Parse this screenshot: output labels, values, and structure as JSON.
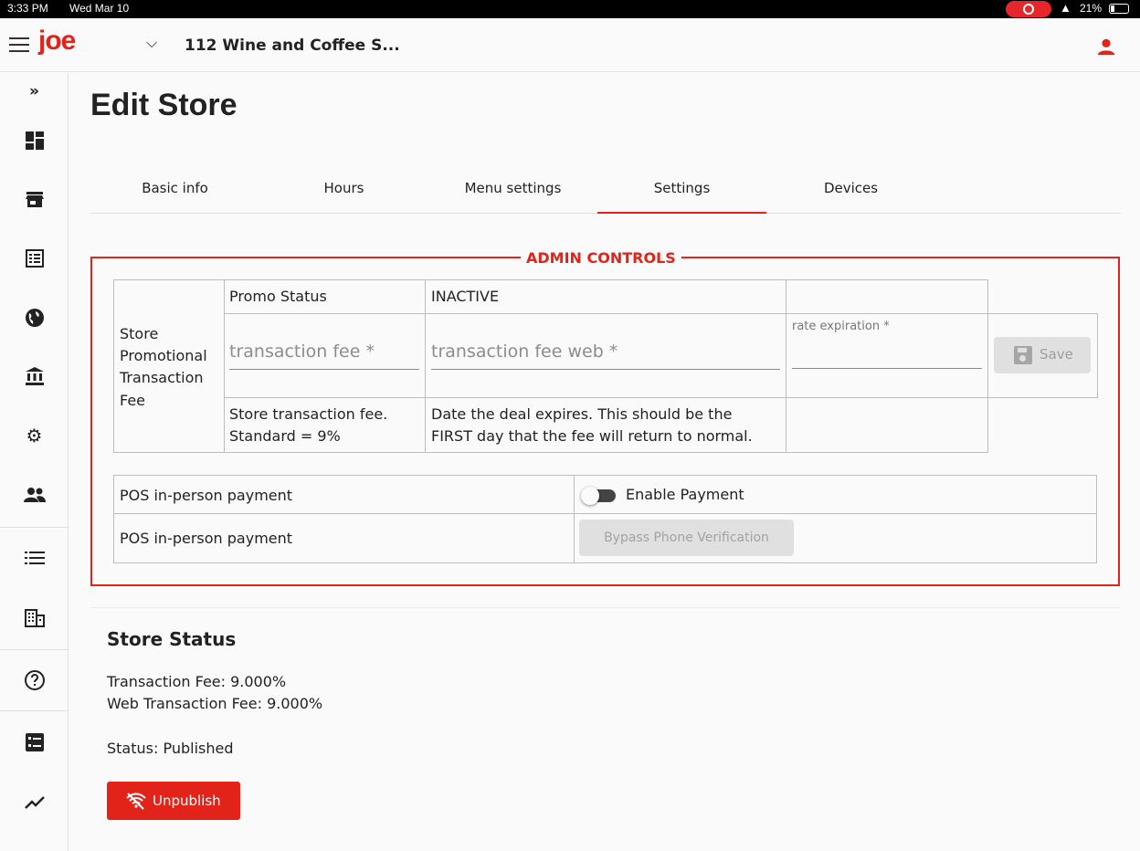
{
  "status_bar": {
    "time": "3:33 PM",
    "date": "Wed Mar 10",
    "battery": "21%"
  },
  "app_bar": {
    "logo": "joe",
    "store_name": "112 Wine and Coffee S..."
  },
  "page": {
    "title": "Edit Store"
  },
  "tabs": [
    {
      "label": "Basic info"
    },
    {
      "label": "Hours"
    },
    {
      "label": "Menu settings"
    },
    {
      "label": "Settings",
      "active": true
    },
    {
      "label": "Devices"
    }
  ],
  "admin": {
    "legend": "ADMIN CONTROLS",
    "promo": {
      "row_label_1": "Store",
      "row_label_2": "Promotional",
      "row_label_3": "Transaction",
      "row_label_4": "Fee",
      "status_label": "Promo Status",
      "status_value": "INACTIVE",
      "fee_placeholder": "transaction fee *",
      "fee_web_placeholder": "transaction fee web *",
      "rate_expiration_label": "rate expiration *",
      "fee_help_1": "Store transaction fee.",
      "fee_help_2": "Standard = 9%",
      "expire_help_1": "Date the deal expires. This should be the",
      "expire_help_2": "FIRST day that the fee will return to normal.",
      "save_label": "Save"
    },
    "pos": {
      "row1_label": "POS in-person payment",
      "toggle_label": "Enable Payment",
      "toggle_on": false,
      "row2_label": "POS in-person payment",
      "bypass_label": "Bypass Phone Verification"
    }
  },
  "store_status": {
    "title": "Store Status",
    "transaction_fee": "Transaction Fee: 9.000%",
    "web_transaction_fee": "Web Transaction Fee: 9.000%",
    "status": "Status: Published",
    "unpublish_label": "Unpublish"
  },
  "colors": {
    "accent": "#e2231a"
  }
}
